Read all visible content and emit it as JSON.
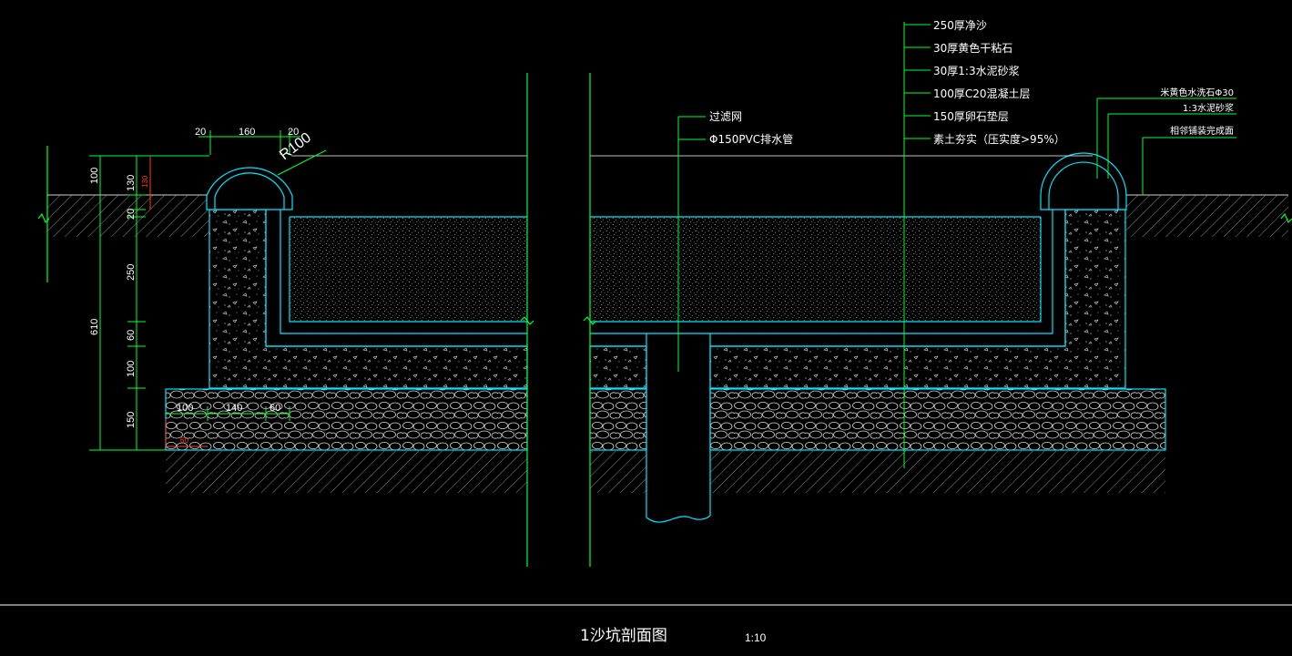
{
  "drawing": {
    "title": "1沙坑剖面图",
    "scale": "1:10"
  },
  "layer_labels": [
    "250厚净沙",
    "30厚黄色干粘石",
    "30厚1:3水泥砂浆",
    "100厚C20混凝土层",
    "150厚卵石垫层",
    "素土夯实（压实度>95%）"
  ],
  "drain_labels": [
    "过滤网",
    "Φ150PVC排水管"
  ],
  "edge_labels": [
    "米黄色水洗石Φ30",
    "1:3水泥砂浆",
    "相邻铺装完成面"
  ],
  "dimensions": {
    "top": [
      "20",
      "160",
      "20"
    ],
    "radius": "R100",
    "vertical_outer": "610",
    "vertical_left": [
      "100",
      "20"
    ],
    "vertical_mid": [
      "130",
      "250",
      "60",
      "100",
      "150"
    ],
    "vertical_red": "130",
    "bottom": [
      "100",
      "140",
      "60"
    ],
    "bottom_red": "60"
  },
  "colors": {
    "background": "#000000",
    "outline": "#00e5ff",
    "leader": "#00ff33",
    "red_dim": "#ff3b1f",
    "hatch": "#8a8a8a"
  }
}
